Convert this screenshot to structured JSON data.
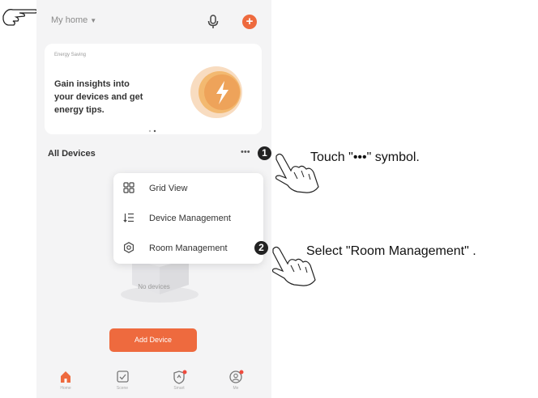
{
  "header": {
    "home_label": "My home"
  },
  "banner": {
    "tag": "Energy Saving",
    "text": "Gain insights into\nyour devices and get\nenergy tips."
  },
  "devices": {
    "section_title": "All Devices",
    "more_label": "•••",
    "empty_text": "No devices",
    "add_button": "Add Device"
  },
  "menu": {
    "items": [
      {
        "label": "Grid View",
        "icon": "grid-icon"
      },
      {
        "label": "Device Management",
        "icon": "list-sort-icon"
      },
      {
        "label": "Room Management",
        "icon": "room-settings-icon"
      }
    ]
  },
  "tabbar": {
    "tabs": [
      {
        "label": "Home",
        "icon": "home-icon"
      },
      {
        "label": "Scene",
        "icon": "check-square-icon"
      },
      {
        "label": "Smart",
        "icon": "smart-icon"
      },
      {
        "label": "Me",
        "icon": "profile-icon"
      }
    ]
  },
  "annotations": {
    "step1_number": "1",
    "step1_text": "Touch \"•••\" symbol.",
    "step2_number": "2",
    "step2_text": "Select \"Room Management\" ."
  },
  "colors": {
    "accent": "#ee6a3e",
    "background": "#f4f4f5"
  }
}
